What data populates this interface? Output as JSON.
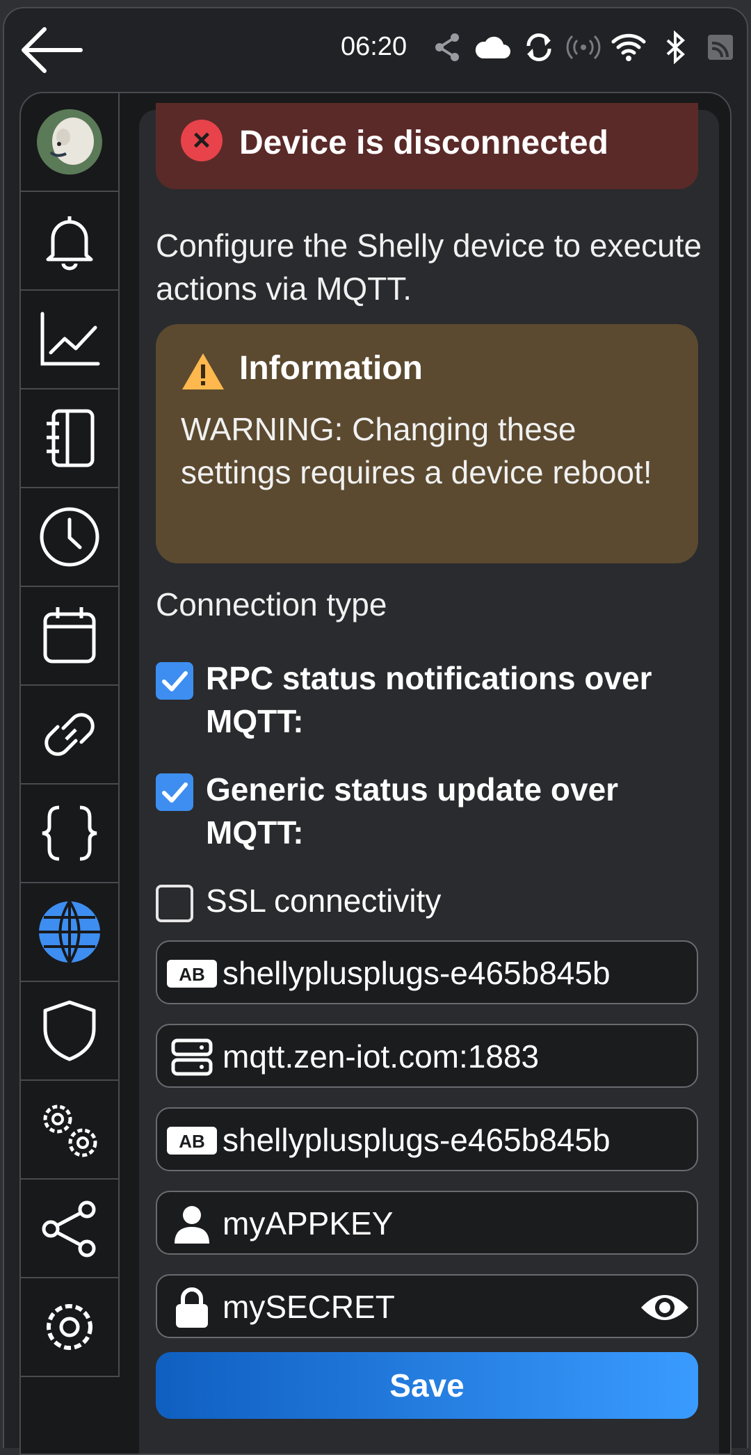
{
  "status_bar": {
    "time": "06:20"
  },
  "error_banner": {
    "text": "Device is disconnected"
  },
  "intro": "Configure the Shelly device to execute actions via MQTT.",
  "info": {
    "title": "Information",
    "body": "WARNING: Changing these settings requires a device reboot!"
  },
  "connection_type_label": "Connection type",
  "options": [
    {
      "label": "RPC status notifications over MQTT:",
      "checked": true
    },
    {
      "label": "Generic status update over MQTT:",
      "checked": true
    },
    {
      "label": "SSL connectivity",
      "checked": false
    }
  ],
  "fields": {
    "client_id": "shellyplusplugs-e465b845b",
    "server": "mqtt.zen-iot.com:1883",
    "topic_prefix": "shellyplusplugs-e465b845b",
    "username": "myAPPKEY",
    "password": "mySECRET"
  },
  "save_label": "Save",
  "colors": {
    "accent": "#3d8ef0",
    "error_bg": "#5a2a28",
    "warning_bg": "#5b4a30",
    "active_icon": "#3d8ef0"
  },
  "sidebar_icons": [
    "avatar",
    "bell-icon",
    "chart-icon",
    "notebook-icon",
    "clock-icon",
    "calendar-icon",
    "link-icon",
    "braces-icon",
    "globe-icon",
    "shield-icon",
    "gears-icon",
    "share-icon",
    "settings-icon"
  ]
}
